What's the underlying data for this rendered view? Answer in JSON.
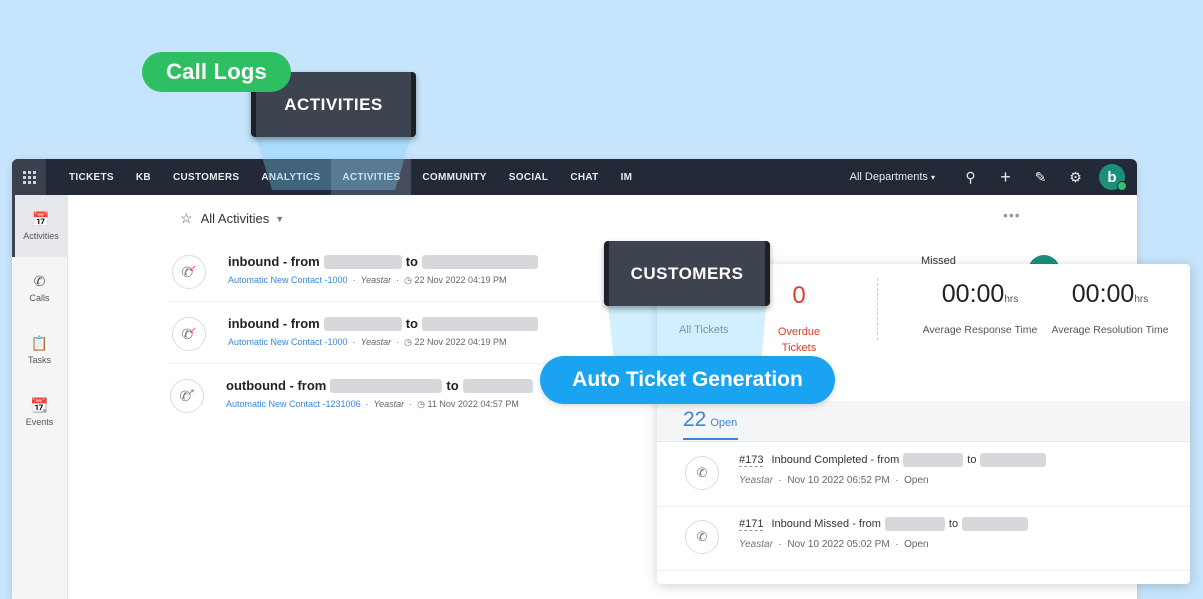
{
  "callouts": {
    "call_logs": "Call Logs",
    "activities": "ACTIVITIES",
    "customers": "CUSTOMERS",
    "auto_ticket": "Auto Ticket Generation"
  },
  "nav": {
    "items": [
      "TICKETS",
      "KB",
      "CUSTOMERS",
      "ANALYTICS",
      "ACTIVITIES",
      "COMMUNITY",
      "SOCIAL",
      "CHAT",
      "IM"
    ],
    "active": "ACTIVITIES",
    "department": "All Departments",
    "avatar_letter": "b",
    "icons": [
      "search-icon",
      "plus-icon",
      "compose-icon",
      "gear-icon"
    ]
  },
  "sidebar": {
    "items": [
      {
        "label": "Activities",
        "icon": "activities-icon"
      },
      {
        "label": "Calls",
        "icon": "phone-icon"
      },
      {
        "label": "Tasks",
        "icon": "clipboard-icon"
      },
      {
        "label": "Events",
        "icon": "calendar-icon"
      }
    ]
  },
  "activities": {
    "header": "All Activities",
    "rows": [
      {
        "direction": "inbound - from",
        "to": "to",
        "contact": "Automatic New Contact -1000",
        "source": "Yeastar",
        "date": "22 Nov 2022 04:19 PM"
      },
      {
        "direction": "inbound - from",
        "to": "to",
        "contact": "Automatic New Contact -1000",
        "source": "Yeastar",
        "date": "22 Nov 2022 04:19 PM"
      },
      {
        "direction": "outbound - from",
        "to": "to",
        "contact": "Automatic New Contact -1231006",
        "source": "Yeastar",
        "date": "11 Nov 2022 04:57 PM"
      }
    ],
    "behind_label": "Missed"
  },
  "customer_panel": {
    "all_tickets_label": "All Tickets",
    "overdue_value": "0",
    "overdue_label_1": "Overdue",
    "overdue_label_2": "Tickets",
    "avg_response_value": "00:00",
    "avg_response_unit": "hrs",
    "avg_response_label": "Average Response Time",
    "avg_resolution_value": "00:00",
    "avg_resolution_unit": "hrs",
    "avg_resolution_label": "Average Resolution Time",
    "open_count": "22",
    "open_label": "Open",
    "tickets": [
      {
        "number": "#173",
        "title": "Inbound Completed - from",
        "to": "to",
        "source": "Yeastar",
        "date": "Nov 10 2022 06:52 PM",
        "status": "Open"
      },
      {
        "number": "#171",
        "title": "Inbound Missed - from",
        "to": "to",
        "source": "Yeastar",
        "date": "Nov 10 2022 05:02 PM",
        "status": "Open"
      }
    ]
  },
  "colors": {
    "green": "#2fbf63",
    "blue": "#1aa3f0",
    "topbar": "#232937",
    "overdue": "#e03b2b",
    "link": "#3b86d6"
  }
}
